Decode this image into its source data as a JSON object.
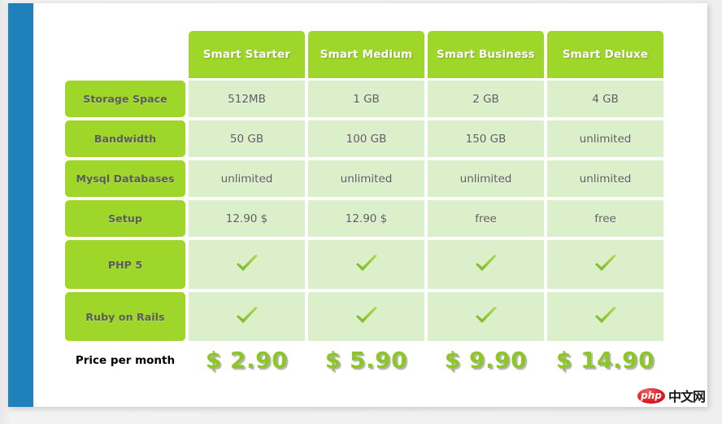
{
  "colors": {
    "rail": "#2080b9",
    "header_green": "#9ed62a",
    "cell_green": "#dcefcb",
    "price_green": "#8cc627",
    "card": "#ffffff",
    "page_bg": "#efefef"
  },
  "table": {
    "corner_label": "",
    "plans": [
      {
        "name": "Smart Starter"
      },
      {
        "name": "Smart Medium"
      },
      {
        "name": "Smart Business"
      },
      {
        "name": "Smart Deluxe"
      }
    ],
    "rows": [
      {
        "label": "Storage Space",
        "size": "short",
        "values": [
          "512MB",
          "1 GB",
          "2 GB",
          "4 GB"
        ]
      },
      {
        "label": "Bandwidth",
        "size": "short",
        "values": [
          "50 GB",
          "100 GB",
          "150 GB",
          "unlimited"
        ]
      },
      {
        "label": "Mysql Databases",
        "size": "short",
        "values": [
          "unlimited",
          "unlimited",
          "unlimited",
          "unlimited"
        ]
      },
      {
        "label": "Setup",
        "size": "short",
        "values": [
          "12.90 $",
          "12.90 $",
          "free",
          "free"
        ]
      },
      {
        "label": "PHP 5",
        "size": "tall",
        "values": [
          "check-icon",
          "check-icon",
          "check-icon",
          "check-icon"
        ]
      },
      {
        "label": "Ruby on Rails",
        "size": "tall",
        "values": [
          "check-icon",
          "check-icon",
          "check-icon",
          "check-icon"
        ]
      }
    ],
    "price_row": {
      "label": "Price per month",
      "values": [
        "$ 2.90",
        "$ 5.90",
        "$ 9.90",
        "$ 14.90"
      ]
    }
  },
  "watermark": {
    "badge": "php",
    "text": "中文网"
  }
}
